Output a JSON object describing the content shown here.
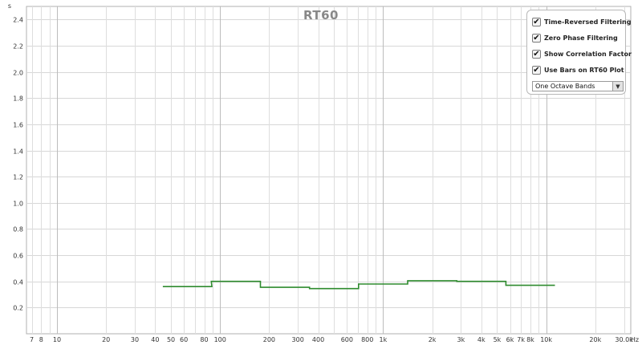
{
  "chart_data": {
    "type": "line",
    "title": "RT60",
    "ylabel": "s",
    "xunit": "Hz",
    "xscale": "log",
    "xlim": [
      6.5,
      33000
    ],
    "ylim": [
      0.0,
      2.5
    ],
    "grid": true,
    "line_color": "#2e8b2e",
    "y_ticks": [
      {
        "value": 0.2,
        "label": "0.2"
      },
      {
        "value": 0.4,
        "label": "0.4"
      },
      {
        "value": 0.6,
        "label": "0.6"
      },
      {
        "value": 0.8,
        "label": "0.8"
      },
      {
        "value": 1.0,
        "label": "1.0"
      },
      {
        "value": 1.2,
        "label": "1.2"
      },
      {
        "value": 1.4,
        "label": "1.4"
      },
      {
        "value": 1.6,
        "label": "1.6"
      },
      {
        "value": 1.8,
        "label": "1.8"
      },
      {
        "value": 2.0,
        "label": "2.0"
      },
      {
        "value": 2.2,
        "label": "2.2"
      },
      {
        "value": 2.4,
        "label": "2.4"
      }
    ],
    "x_ticks": [
      {
        "value": 7,
        "label": "7"
      },
      {
        "value": 8,
        "label": "8"
      },
      {
        "value": 10,
        "label": "10"
      },
      {
        "value": 20,
        "label": "20"
      },
      {
        "value": 30,
        "label": "30"
      },
      {
        "value": 40,
        "label": "40"
      },
      {
        "value": 50,
        "label": "50"
      },
      {
        "value": 60,
        "label": "60"
      },
      {
        "value": 80,
        "label": "80"
      },
      {
        "value": 100,
        "label": "100"
      },
      {
        "value": 200,
        "label": "200"
      },
      {
        "value": 300,
        "label": "300"
      },
      {
        "value": 400,
        "label": "400"
      },
      {
        "value": 600,
        "label": "600"
      },
      {
        "value": 800,
        "label": "800"
      },
      {
        "value": 1000,
        "label": "1k"
      },
      {
        "value": 2000,
        "label": "2k"
      },
      {
        "value": 3000,
        "label": "3k"
      },
      {
        "value": 4000,
        "label": "4k"
      },
      {
        "value": 5000,
        "label": "5k"
      },
      {
        "value": 6000,
        "label": "6k"
      },
      {
        "value": 7000,
        "label": "7k"
      },
      {
        "value": 8000,
        "label": "8k"
      },
      {
        "value": 10000,
        "label": "10k"
      },
      {
        "value": 20000,
        "label": "20k"
      },
      {
        "value": 30000,
        "label": "30.0k"
      }
    ],
    "bands": [
      {
        "center": 63,
        "value": 0.36
      },
      {
        "center": 125,
        "value": 0.4
      },
      {
        "center": 250,
        "value": 0.355
      },
      {
        "center": 500,
        "value": 0.345
      },
      {
        "center": 1000,
        "value": 0.38
      },
      {
        "center": 2000,
        "value": 0.405
      },
      {
        "center": 4000,
        "value": 0.4
      },
      {
        "center": 8000,
        "value": 0.37
      }
    ]
  },
  "options": {
    "time_reversed": {
      "label": "Time-Reversed Filtering",
      "checked": true
    },
    "zero_phase": {
      "label": "Zero Phase Filtering",
      "checked": true
    },
    "correlation": {
      "label": "Show Correlation Factor",
      "checked": true
    },
    "use_bars": {
      "label": "Use Bars on RT60 Plot",
      "checked": true
    },
    "band_select": {
      "value": "One Octave Bands"
    }
  }
}
